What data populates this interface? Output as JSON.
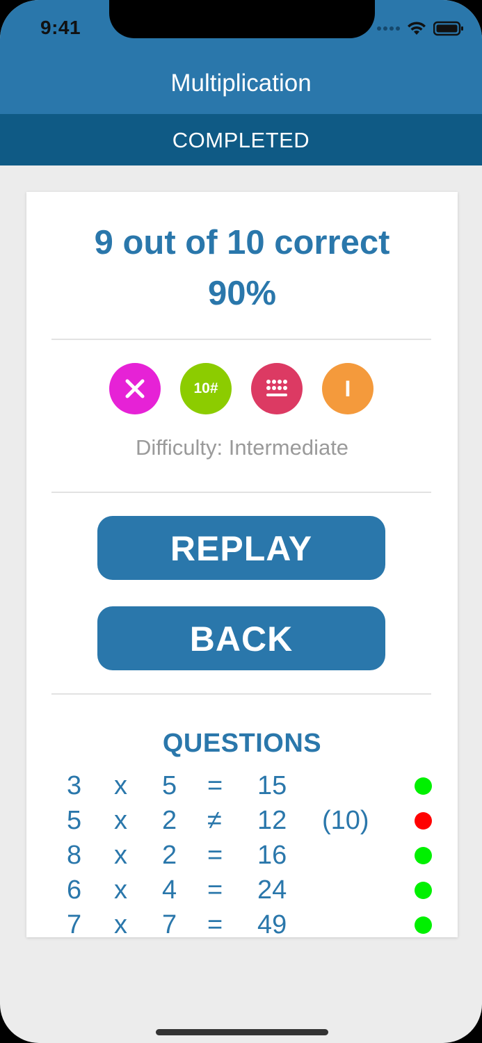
{
  "status_bar": {
    "time": "9:41"
  },
  "header": {
    "title": "Multiplication",
    "subtitle": "COMPLETED"
  },
  "result": {
    "score": "9 out of 10 correct",
    "percent": "90%"
  },
  "settings_icons": [
    {
      "name": "multiply-icon",
      "glyph": "×",
      "color": "#e622d6"
    },
    {
      "name": "number-range-icon",
      "glyph": "10#",
      "color": "#8ccc00"
    },
    {
      "name": "keypad-icon",
      "glyph": "",
      "color": "#dc3a63"
    },
    {
      "name": "level-icon",
      "glyph": "I",
      "color": "#f49a3c"
    }
  ],
  "difficulty": "Difficulty: Intermediate",
  "buttons": {
    "replay": "REPLAY",
    "back": "BACK"
  },
  "questions": {
    "title": "QUESTIONS",
    "rows": [
      {
        "a": "3",
        "op": "x",
        "b": "5",
        "eq": "=",
        "result": "15",
        "correction": "",
        "status": "correct"
      },
      {
        "a": "5",
        "op": "x",
        "b": "2",
        "eq": "≠",
        "result": "12",
        "correction": "(10)",
        "status": "incorrect"
      },
      {
        "a": "8",
        "op": "x",
        "b": "2",
        "eq": "=",
        "result": "16",
        "correction": "",
        "status": "correct"
      },
      {
        "a": "6",
        "op": "x",
        "b": "4",
        "eq": "=",
        "result": "24",
        "correction": "",
        "status": "correct"
      },
      {
        "a": "7",
        "op": "x",
        "b": "7",
        "eq": "=",
        "result": "49",
        "correction": "",
        "status": "correct"
      }
    ]
  },
  "colors": {
    "primary": "#2a77ab",
    "secondary": "#0f5a85",
    "correct": "#00f000",
    "incorrect": "#ff0000"
  }
}
